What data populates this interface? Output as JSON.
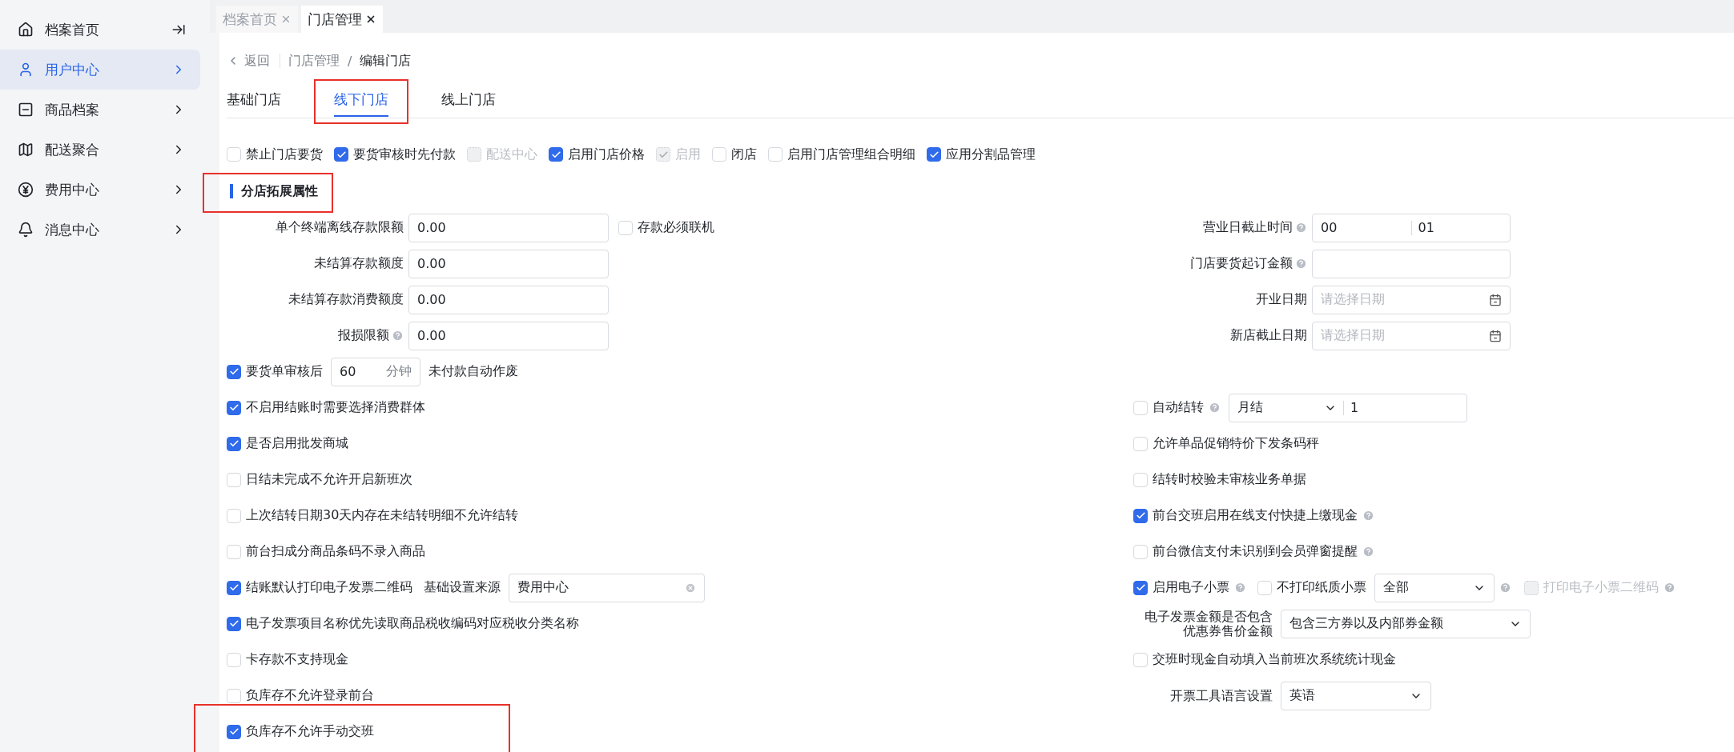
{
  "sidebar": {
    "home": {
      "label": "档案首页"
    },
    "items": [
      {
        "label": "用户中心",
        "selected": true
      },
      {
        "label": "商品档案",
        "selected": false
      },
      {
        "label": "配送聚合",
        "selected": false
      },
      {
        "label": "费用中心",
        "selected": false
      },
      {
        "label": "消息中心",
        "selected": false
      }
    ]
  },
  "page_tabs": [
    {
      "label": "档案首页",
      "selected": false
    },
    {
      "label": "门店管理",
      "selected": true
    }
  ],
  "breadcrumb": {
    "back": "返回",
    "trail": [
      "门店管理",
      "编辑门店"
    ],
    "separator": "/"
  },
  "sub_tabs": [
    {
      "label": "基础门店",
      "selected": false,
      "annotated": false
    },
    {
      "label": "线下门店",
      "selected": true,
      "annotated": true
    },
    {
      "label": "线上门店",
      "selected": false,
      "annotated": false
    }
  ],
  "top_options": [
    {
      "label": "禁止门店要货",
      "checked": false,
      "disabled": false
    },
    {
      "label": "要货审核时先付款",
      "checked": true,
      "disabled": false
    },
    {
      "label": "配送中心",
      "checked": false,
      "disabled": true
    },
    {
      "label": "启用门店价格",
      "checked": true,
      "disabled": false
    },
    {
      "label": "启用",
      "checked": true,
      "disabled": true
    },
    {
      "label": "闭店",
      "checked": false,
      "disabled": false
    },
    {
      "label": "启用门店管理组合明细",
      "checked": false,
      "disabled": false
    },
    {
      "label": "应用分割品管理",
      "checked": true,
      "disabled": false
    }
  ],
  "section": {
    "title": "分店拓展属性",
    "annotated": true
  },
  "left_fields": [
    {
      "label": "单个终端离线存款限额",
      "help": false,
      "value": "0.00",
      "extra": {
        "label": "存款必须联机",
        "checked": false
      }
    },
    {
      "label": "未结算存款额度",
      "help": false,
      "value": "0.00"
    },
    {
      "label": "未结算存款消费额度",
      "help": false,
      "value": "0.00"
    },
    {
      "label": "报损限额",
      "help": true,
      "value": "0.00"
    }
  ],
  "right_fields": [
    {
      "kind": "split",
      "label": "营业日截止时间",
      "help": true,
      "value": "00",
      "value_2": "01"
    },
    {
      "kind": "text",
      "label": "门店要货起订金额",
      "help": true
    },
    {
      "kind": "date",
      "label": "开业日期",
      "help": false,
      "placeholder": "请选择日期"
    },
    {
      "kind": "date",
      "label": "新店截止日期",
      "help": false,
      "placeholder": "请选择日期"
    }
  ],
  "left_options": [
    {
      "kind": "checkbox_input",
      "label": "要货单审核后",
      "checked": true,
      "value": "60",
      "unit": "分钟",
      "suffix": "未付款自动作废",
      "annotated": false
    },
    {
      "kind": "checkbox",
      "label": "不启用结账时需要选择消费群体",
      "checked": true,
      "annotated": false
    },
    {
      "kind": "checkbox",
      "label": "是否启用批发商城",
      "checked": true,
      "annotated": false
    },
    {
      "kind": "checkbox",
      "label": "日结未完成不允许开启新班次",
      "checked": false,
      "annotated": false
    },
    {
      "kind": "checkbox",
      "label": "上次结转日期30天内存在未结转明细不允许结转",
      "checked": false,
      "annotated": false
    },
    {
      "kind": "checkbox",
      "label": "前台扫成分商品条码不录入商品",
      "checked": false,
      "annotated": false
    },
    {
      "kind": "checkbox_source",
      "label": "结账默认打印电子发票二维码",
      "checked": true,
      "field_label": "基础设置来源",
      "value": "费用中心",
      "annotated": false
    },
    {
      "kind": "checkbox",
      "label": "电子发票项目名称优先读取商品税收编码对应税收分类名称",
      "checked": true,
      "annotated": false
    },
    {
      "kind": "checkbox",
      "label": "卡存款不支持现金",
      "checked": false,
      "annotated": false
    },
    {
      "kind": "checkbox",
      "label": "负库存不允许登录前台",
      "checked": false,
      "annotated": false
    },
    {
      "kind": "checkbox",
      "label": "负库存不允许手动交班",
      "checked": true,
      "annotated": true
    }
  ],
  "right_options": [
    {
      "kind": "checkbox_split",
      "label": "自动结转",
      "checked": false,
      "help": true,
      "select": "月结",
      "value": "1"
    },
    {
      "kind": "checkbox",
      "label": "允许单品促销特价下发条码秤",
      "checked": false,
      "help": false
    },
    {
      "kind": "checkbox",
      "label": "结转时校验未审核业务单据",
      "checked": false,
      "help": false
    },
    {
      "kind": "checkbox",
      "label": "前台交班启用在线支付快捷上缴现金",
      "checked": true,
      "help": true
    },
    {
      "kind": "checkbox",
      "label": "前台微信支付未识别到会员弹窗提醒",
      "checked": false,
      "help": true
    },
    {
      "kind": "ticket",
      "label": "启用电子小票",
      "checked": true,
      "help": true,
      "paper_label": "不打印纸质小票",
      "paper_checked": false,
      "select": "全部",
      "qr_label": "打印电子小票二维码",
      "qr_checked": false,
      "qr_disabled": true
    },
    {
      "kind": "select",
      "label_lines": [
        "电子发票金额是否包含",
        "优惠券售价金额"
      ],
      "value": "包含三方券以及内部券金额"
    },
    {
      "kind": "checkbox",
      "label": "交班时现金自动填入当前班次系统统计现金",
      "checked": false,
      "help": false
    },
    {
      "kind": "select",
      "label_lines": [
        "开票工具语言设置"
      ],
      "value": "英语"
    }
  ]
}
